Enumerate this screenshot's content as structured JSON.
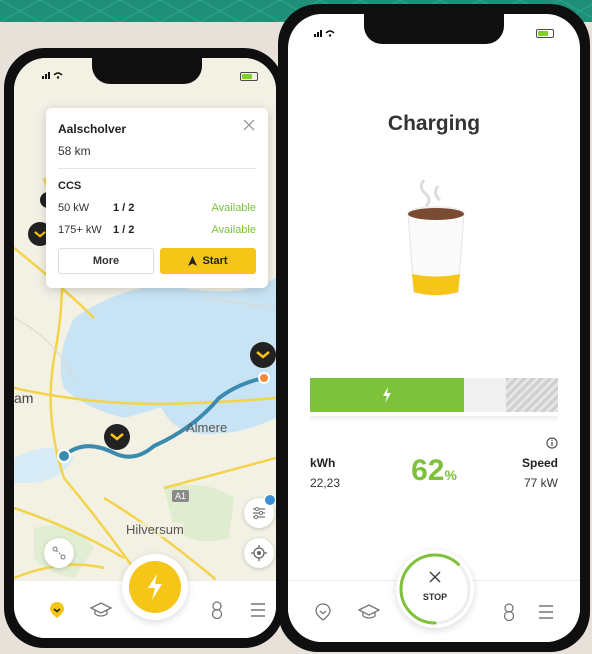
{
  "left_phone": {
    "popup": {
      "title": "Aalscholver",
      "distance": "58 km",
      "connector": "CCS",
      "rows": [
        {
          "power": "50 kW",
          "count": "1 / 2",
          "status": "Available"
        },
        {
          "power": "175+ kW",
          "count": "1 / 2",
          "status": "Available"
        }
      ],
      "more_label": "More",
      "start_label": "Start"
    },
    "map_labels": {
      "almere": "Almere",
      "hilversum": "Hilversum",
      "am": "am",
      "a1": "A1"
    }
  },
  "right_phone": {
    "title": "Charging",
    "kwh_label": "kWh",
    "kwh_value": "22,23",
    "percent_value": "62",
    "percent_sign": "%",
    "speed_label": "Speed",
    "speed_value": "77 kW",
    "progress_fraction": 0.62,
    "stop_label": "STOP"
  },
  "colors": {
    "accent_yellow": "#f5c518",
    "accent_green": "#7ec13a",
    "route_blue": "#3b8bb0",
    "water": "#c8e4f4"
  }
}
